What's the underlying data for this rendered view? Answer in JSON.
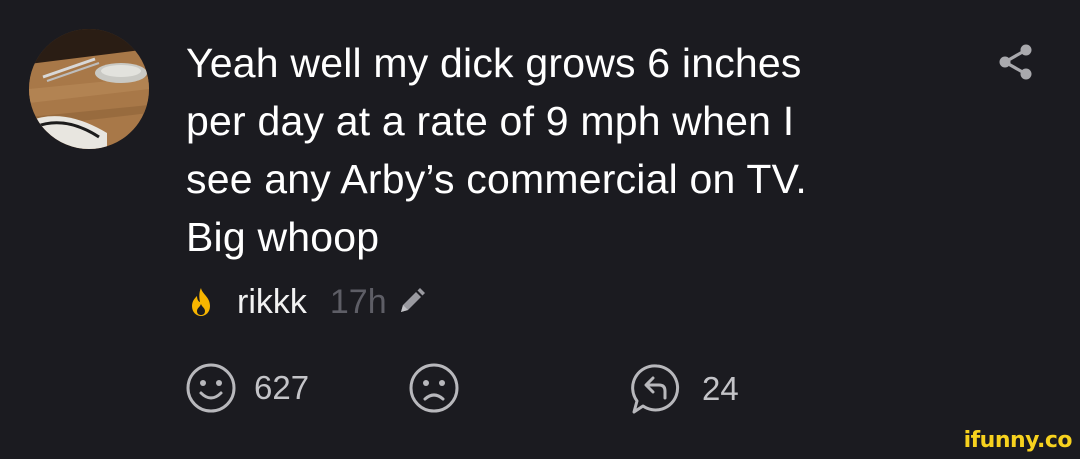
{
  "comment": {
    "avatar_icon": "user-avatar-photo",
    "lines": [
      "Yeah well my dick grows 6 inches",
      "per day at a rate of 9 mph when I",
      "see any Arby’s commercial on TV.",
      "Big whoop"
    ],
    "share_icon": "share-icon",
    "author": {
      "badge_icon": "fire-icon",
      "username": "rikkk",
      "time": "17h",
      "edited_icon": "pencil-icon"
    },
    "actions": {
      "smile_icon": "smile-icon",
      "smile_count": "627",
      "frown_icon": "frown-icon",
      "reply_icon": "reply-icon",
      "reply_count": "24"
    }
  },
  "watermark": "ifunny.co",
  "colors": {
    "background": "#1b1b20",
    "text": "#ffffff",
    "muted": "#5e5e66",
    "icon": "#b8b8bc",
    "fire": "#f7b500",
    "watermark": "#f7d21e"
  }
}
